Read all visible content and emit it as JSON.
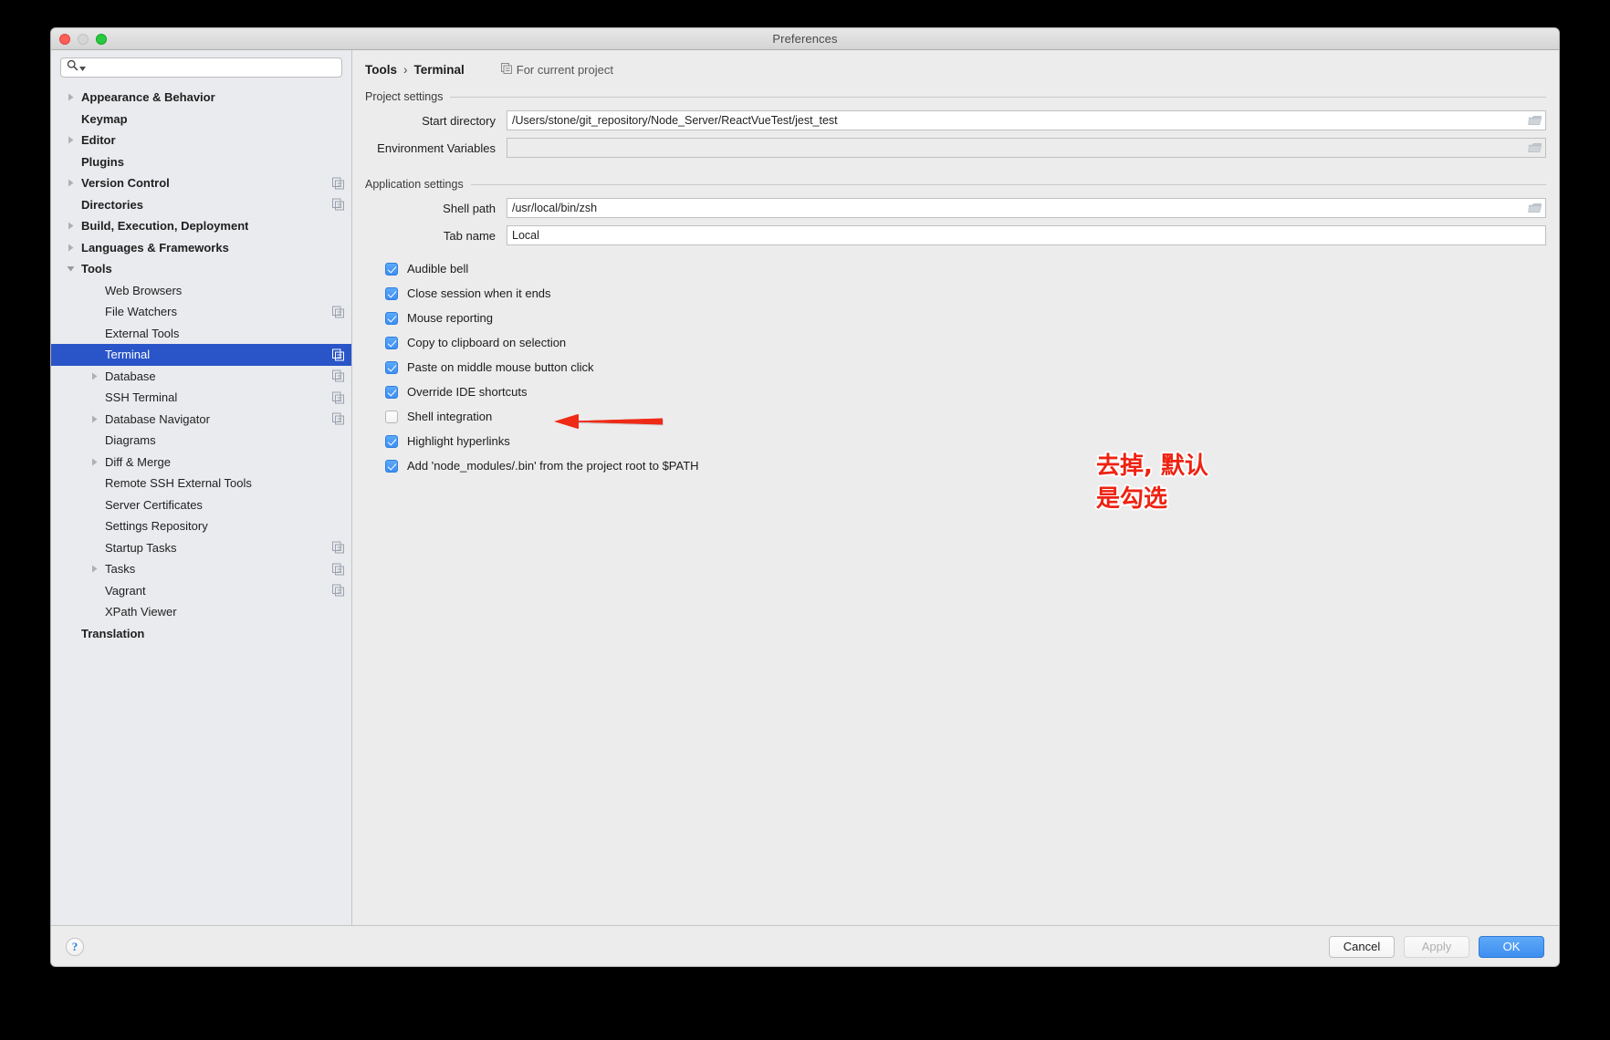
{
  "window": {
    "title": "Preferences",
    "traffic_lights": [
      "close-button",
      "minimize-button",
      "maximize-button"
    ]
  },
  "search": {
    "value": "",
    "placeholder": ""
  },
  "sidebar": {
    "items": [
      {
        "label": "Appearance & Behavior",
        "indent": 0,
        "twisty": "collapsed",
        "bold": true,
        "selected": false,
        "project_icon": false
      },
      {
        "label": "Keymap",
        "indent": 0,
        "twisty": "none",
        "bold": true,
        "selected": false,
        "project_icon": false
      },
      {
        "label": "Editor",
        "indent": 0,
        "twisty": "collapsed",
        "bold": true,
        "selected": false,
        "project_icon": false
      },
      {
        "label": "Plugins",
        "indent": 0,
        "twisty": "none",
        "bold": true,
        "selected": false,
        "project_icon": false
      },
      {
        "label": "Version Control",
        "indent": 0,
        "twisty": "collapsed",
        "bold": true,
        "selected": false,
        "project_icon": true
      },
      {
        "label": "Directories",
        "indent": 0,
        "twisty": "none",
        "bold": true,
        "selected": false,
        "project_icon": true
      },
      {
        "label": "Build, Execution, Deployment",
        "indent": 0,
        "twisty": "collapsed",
        "bold": true,
        "selected": false,
        "project_icon": false
      },
      {
        "label": "Languages & Frameworks",
        "indent": 0,
        "twisty": "collapsed",
        "bold": true,
        "selected": false,
        "project_icon": false
      },
      {
        "label": "Tools",
        "indent": 0,
        "twisty": "expanded",
        "bold": true,
        "selected": false,
        "project_icon": false
      },
      {
        "label": "Web Browsers",
        "indent": 1,
        "twisty": "none",
        "bold": false,
        "selected": false,
        "project_icon": false
      },
      {
        "label": "File Watchers",
        "indent": 1,
        "twisty": "none",
        "bold": false,
        "selected": false,
        "project_icon": true
      },
      {
        "label": "External Tools",
        "indent": 1,
        "twisty": "none",
        "bold": false,
        "selected": false,
        "project_icon": false
      },
      {
        "label": "Terminal",
        "indent": 1,
        "twisty": "none",
        "bold": false,
        "selected": true,
        "project_icon": true
      },
      {
        "label": "Database",
        "indent": 1,
        "twisty": "collapsed",
        "bold": false,
        "selected": false,
        "project_icon": true
      },
      {
        "label": "SSH Terminal",
        "indent": 1,
        "twisty": "none",
        "bold": false,
        "selected": false,
        "project_icon": true
      },
      {
        "label": "Database Navigator",
        "indent": 1,
        "twisty": "collapsed",
        "bold": false,
        "selected": false,
        "project_icon": true
      },
      {
        "label": "Diagrams",
        "indent": 1,
        "twisty": "none",
        "bold": false,
        "selected": false,
        "project_icon": false
      },
      {
        "label": "Diff & Merge",
        "indent": 1,
        "twisty": "collapsed",
        "bold": false,
        "selected": false,
        "project_icon": false
      },
      {
        "label": "Remote SSH External Tools",
        "indent": 1,
        "twisty": "none",
        "bold": false,
        "selected": false,
        "project_icon": false
      },
      {
        "label": "Server Certificates",
        "indent": 1,
        "twisty": "none",
        "bold": false,
        "selected": false,
        "project_icon": false
      },
      {
        "label": "Settings Repository",
        "indent": 1,
        "twisty": "none",
        "bold": false,
        "selected": false,
        "project_icon": false
      },
      {
        "label": "Startup Tasks",
        "indent": 1,
        "twisty": "none",
        "bold": false,
        "selected": false,
        "project_icon": true
      },
      {
        "label": "Tasks",
        "indent": 1,
        "twisty": "collapsed",
        "bold": false,
        "selected": false,
        "project_icon": true
      },
      {
        "label": "Vagrant",
        "indent": 1,
        "twisty": "none",
        "bold": false,
        "selected": false,
        "project_icon": true
      },
      {
        "label": "XPath Viewer",
        "indent": 1,
        "twisty": "none",
        "bold": false,
        "selected": false,
        "project_icon": false
      },
      {
        "label": "Translation",
        "indent": 0,
        "twisty": "none",
        "bold": true,
        "selected": false,
        "project_icon": false
      }
    ]
  },
  "panel": {
    "breadcrumb": {
      "parent": "Tools",
      "separator": "›",
      "current": "Terminal",
      "scope_label": "For current project"
    },
    "project_settings": {
      "title": "Project settings",
      "fields": [
        {
          "label": "Start directory",
          "value": "/Users/stone/git_repository/Node_Server/ReactVueTest/jest_test",
          "placeholder": "",
          "browse": true,
          "style": "white"
        },
        {
          "label": "Environment Variables",
          "value": "",
          "placeholder": "",
          "browse": true,
          "style": "grey"
        }
      ]
    },
    "application_settings": {
      "title": "Application settings",
      "fields": [
        {
          "label": "Shell path",
          "value": "/usr/local/bin/zsh",
          "placeholder": "",
          "browse": true,
          "style": "white"
        },
        {
          "label": "Tab name",
          "value": "Local",
          "placeholder": "",
          "browse": false,
          "style": "white"
        }
      ],
      "checkboxes": [
        {
          "label": "Audible bell",
          "checked": true
        },
        {
          "label": "Close session when it ends",
          "checked": true
        },
        {
          "label": "Mouse reporting",
          "checked": true
        },
        {
          "label": "Copy to clipboard on selection",
          "checked": true
        },
        {
          "label": "Paste on middle mouse button click",
          "checked": true
        },
        {
          "label": "Override IDE shortcuts",
          "checked": true
        },
        {
          "label": "Shell integration",
          "checked": false
        },
        {
          "label": "Highlight hyperlinks",
          "checked": true
        },
        {
          "label": "Add 'node_modules/.bin' from the project root to $PATH",
          "checked": true
        }
      ]
    }
  },
  "annotation": {
    "text": "去掉, 默认\n是勾选",
    "color": "#ee2211",
    "arrow": "left-arrow-to-shell-integration"
  },
  "footer": {
    "help_label": "?",
    "cancel_label": "Cancel",
    "apply_label": "Apply",
    "ok_label": "OK"
  },
  "colors": {
    "selection_blue": "#2a55c8",
    "checkbox_blue": "#3d8ef4",
    "primary_button": "#3e8ef0",
    "annotation_red": "#ee2211",
    "window_bg": "#ececec",
    "sidebar_bg": "#e9ebee"
  }
}
